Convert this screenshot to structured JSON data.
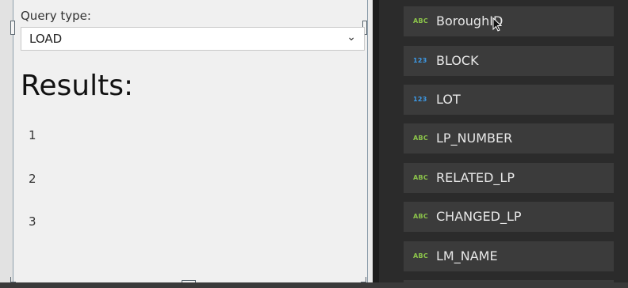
{
  "form": {
    "query_type_label": "Query type:",
    "query_type_value": "LOAD",
    "results_title": "Results:",
    "results": [
      "1",
      "2",
      "3"
    ]
  },
  "fields": [
    {
      "type": "ABC",
      "name": "BoroughID",
      "kind": "text"
    },
    {
      "type": "123",
      "name": "BLOCK",
      "kind": "number"
    },
    {
      "type": "123",
      "name": "LOT",
      "kind": "number"
    },
    {
      "type": "ABC",
      "name": "LP_NUMBER",
      "kind": "text"
    },
    {
      "type": "ABC",
      "name": "RELATED_LP",
      "kind": "text"
    },
    {
      "type": "ABC",
      "name": "CHANGED_LP",
      "kind": "text"
    },
    {
      "type": "ABC",
      "name": "LM_NAME",
      "kind": "text"
    }
  ],
  "colors": {
    "text_type": "#8bc34a",
    "number_type": "#3d9be9",
    "panel_bg": "#2b2b2b",
    "item_bg": "#3b3b3b"
  },
  "icons": {
    "dropdown": "chevron-down-icon",
    "cursor": "mouse-pointer-icon"
  }
}
